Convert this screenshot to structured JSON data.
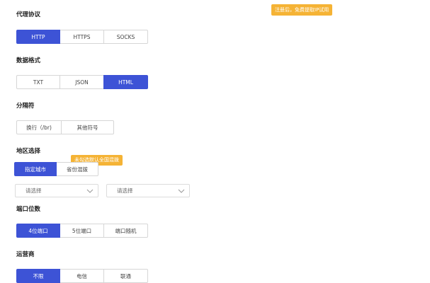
{
  "top_tip": "注册后，免费提取IP试用",
  "protocol": {
    "title": "代理协议",
    "options": [
      "HTTP",
      "HTTPS",
      "SOCKS"
    ],
    "active": 0
  },
  "format": {
    "title": "数据格式",
    "options": [
      "TXT",
      "JSON",
      "HTML"
    ],
    "active": 2
  },
  "separator": {
    "title": "分隔符",
    "options": [
      "换行（/br)",
      "其他符号"
    ],
    "active": -1
  },
  "region": {
    "title": "地区选择",
    "options": [
      "指定城市",
      "省份混拨"
    ],
    "active": 0,
    "tip": "未勾选默认全国混拨",
    "select1_placeholder": "请选择",
    "select2_placeholder": "请选择"
  },
  "port": {
    "title": "端口位数",
    "options": [
      "4位端口",
      "5位端口",
      "端口随机"
    ],
    "active": 0
  },
  "isp": {
    "title": "运营商",
    "options": [
      "不限",
      "电信",
      "联通"
    ],
    "active": 0
  }
}
